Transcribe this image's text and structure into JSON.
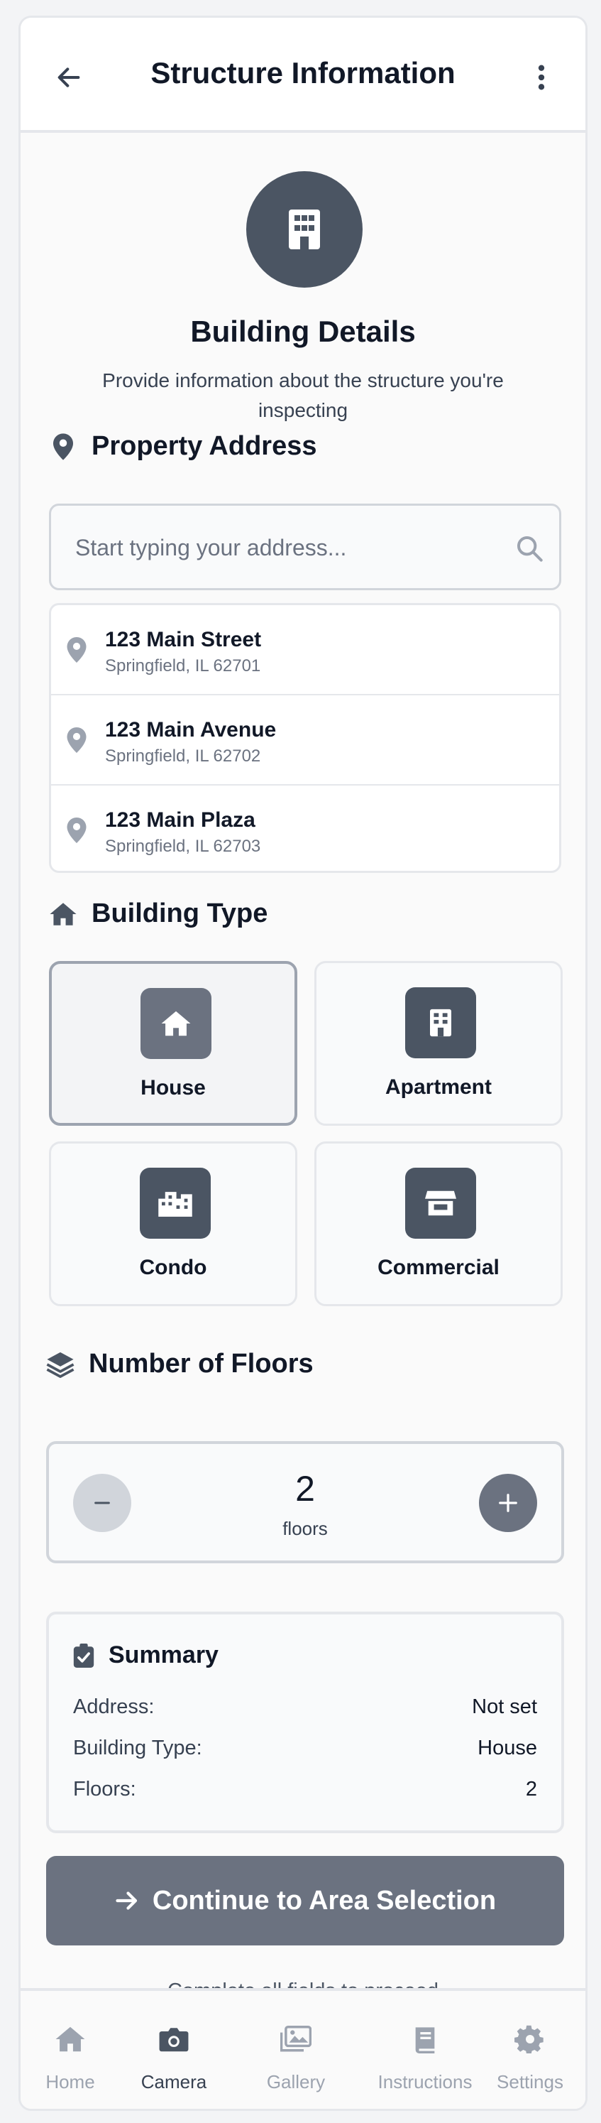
{
  "header": {
    "title": "Structure Information",
    "back_icon": "arrow-left-icon",
    "menu_icon": "more-vertical-icon"
  },
  "hero": {
    "icon": "building-icon",
    "title": "Building Details",
    "subtitle": "Provide information about the structure you're inspecting"
  },
  "address": {
    "section_title": "Property Address",
    "placeholder": "Start typing your address...",
    "value": "",
    "suggestions": [
      {
        "street": "123 Main Street",
        "city": "Springfield, IL 62701"
      },
      {
        "street": "123 Main Avenue",
        "city": "Springfield, IL 62702"
      },
      {
        "street": "123 Main Plaza",
        "city": "Springfield, IL 62703"
      }
    ]
  },
  "building_type": {
    "section_title": "Building Type",
    "selected": "House",
    "options": [
      {
        "label": "House",
        "icon": "house-icon"
      },
      {
        "label": "Apartment",
        "icon": "apartment-icon"
      },
      {
        "label": "Condo",
        "icon": "condo-icon"
      },
      {
        "label": "Commercial",
        "icon": "store-icon"
      }
    ]
  },
  "floors": {
    "section_title": "Number of Floors",
    "value": "2",
    "unit": "floors"
  },
  "summary": {
    "title": "Summary",
    "rows": [
      {
        "label": "Address:",
        "value": "Not set"
      },
      {
        "label": "Building Type:",
        "value": "House"
      },
      {
        "label": "Floors:",
        "value": "2"
      }
    ]
  },
  "cta": {
    "label": "Continue to Area Selection",
    "hint": "Complete all fields to proceed"
  },
  "bottom_nav": {
    "active": "Camera",
    "items": [
      {
        "label": "Home",
        "icon": "home-icon"
      },
      {
        "label": "Camera",
        "icon": "camera-icon"
      },
      {
        "label": "Gallery",
        "icon": "gallery-icon"
      },
      {
        "label": "Instructions",
        "icon": "book-icon"
      },
      {
        "label": "Settings",
        "icon": "gear-icon"
      }
    ]
  },
  "colors": {
    "primary": "#4b5563",
    "button": "#6b7280",
    "border": "#e5e7eb",
    "muted_text": "#6b7280"
  }
}
